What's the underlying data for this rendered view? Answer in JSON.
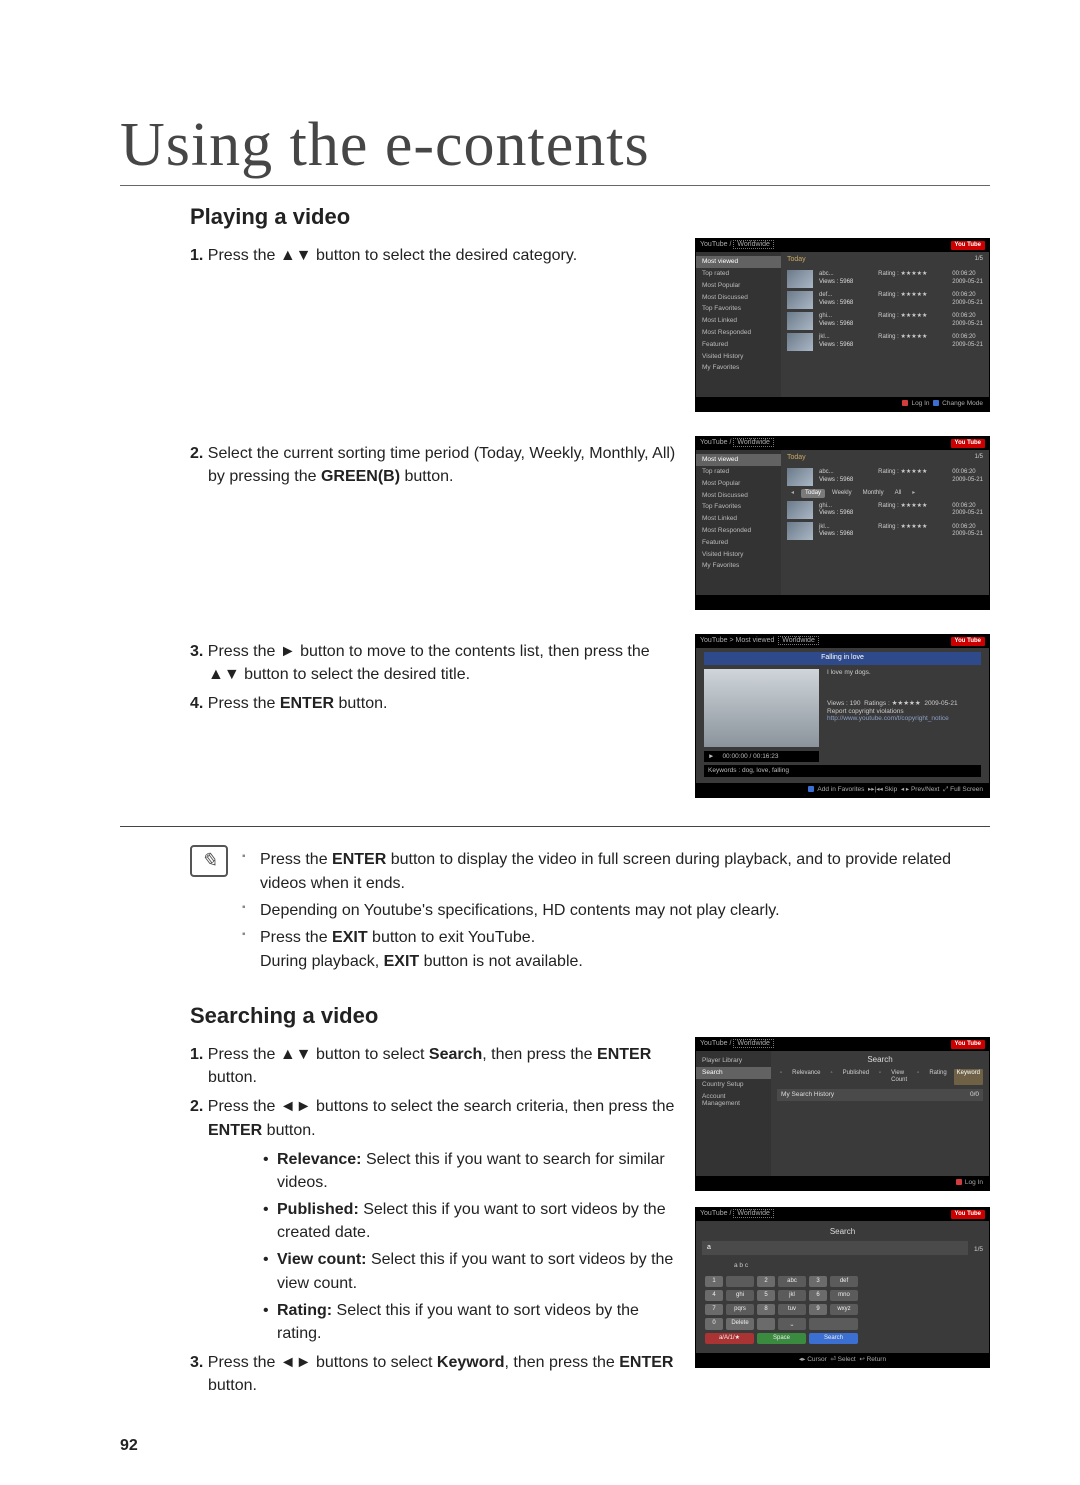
{
  "chapter_title": "Using the e-contents",
  "page_number": "92",
  "section1_title": "Playing a video",
  "section2_title": "Searching a video",
  "step1_1": "1.",
  "step1_1_text": "Press the ▲▼ button to select the desired category.",
  "step1_2a": "2.",
  "step1_2_text_a": "Select the current sorting time period (Today, Weekly, Monthly, All) by pressing the ",
  "step1_2_green": "GREEN(B)",
  "step1_2_text_b": " button.",
  "step1_3a": "3.",
  "step1_3_text": "Press the ► button to move to the contents list, then press the ▲▼ button to select the desired title.",
  "step1_4a": "4.",
  "step1_4_text_a": "Press the ",
  "step1_4_enter": "ENTER",
  "step1_4_text_b": " button.",
  "notes": {
    "n1_a": "Press the ",
    "n1_enter": "ENTER",
    "n1_b": " button to display the video in full screen during playback, and to provide related videos when it ends.",
    "n2": "Depending on Youtube's specifications, HD contents may not play clearly.",
    "n3_a": "Press the ",
    "n3_exit1": "EXIT",
    "n3_b": " button to exit YouTube.",
    "n3_c": "During playback, ",
    "n3_exit2": "EXIT",
    "n3_d": " button is not available."
  },
  "search_steps": {
    "s1_num": "1.",
    "s1_a": "Press the ▲▼ button to select ",
    "s1_search": "Search",
    "s1_b": ", then press the ",
    "s1_enter": "ENTER",
    "s1_c": " button.",
    "s2_num": "2.",
    "s2_a": "Press the ◄► buttons to select the search criteria, then press the ",
    "s2_enter": "ENTER",
    "s2_b": " button.",
    "s3_num": "3.",
    "s3_a": "Press the ◄► buttons to select ",
    "s3_kw": "Keyword",
    "s3_b": ", then press the ",
    "s3_enter": "ENTER",
    "s3_c": " button."
  },
  "search_criteria": {
    "relevance_label": "Relevance:",
    "relevance": " Select this if you want to search for similar videos.",
    "published_label": "Published:",
    "published": " Select this if you want to sort videos by the created date.",
    "viewcount_label": "View count:",
    "viewcount": " Select this if you want to sort videos by the view count.",
    "rating_label": "Rating:",
    "rating": " Select this if you want to sort videos by the rating."
  },
  "mock": {
    "breadcrumb": "YouTube / ",
    "worldwide": "Worldwide",
    "logo": "You Tube",
    "page_indicator": "1/5",
    "period": "Today",
    "side": {
      "most_viewed": "Most viewed",
      "top_rated": "Top rated",
      "most_popular": "Most Popular",
      "most_discussed": "Most Discussed",
      "top_favorites": "Top Favorites",
      "most_linked": "Most Linked",
      "most_responded": "Most Responded",
      "featured": "Featured",
      "visited_history": "Visited History",
      "my_favorites": "My Favorites"
    },
    "rows": {
      "titles": [
        "abc...",
        "def...",
        "ghi...",
        "jkl..."
      ],
      "views": "Views : 5968",
      "rating": "Rating : ★★★★★",
      "duration": "00:06:20",
      "date": "2009-05-21"
    },
    "sort": {
      "today": "Today",
      "weekly": "Weekly",
      "monthly": "Monthly",
      "all": "All"
    },
    "bottom_login": "Log In",
    "bottom_change": "Change Mode",
    "detail": {
      "breadcrumb": "YouTube > Most viewed",
      "banner": "Falling in love",
      "subtitle": "I love my dogs.",
      "meta1": "Views : 190",
      "meta2": "Ratings : ★★★★★",
      "meta3": "2009-05-21",
      "report": "Report copyright violations",
      "link": "http://www.youtube.com/t/copyright_notice",
      "playtime": "00:00:00 / 00:16:23",
      "keywords_label": "Keywords :",
      "keywords": "dog, love, falling",
      "bottom_fav": "Add in Favorites",
      "bottom_skip": "Skip",
      "bottom_prev": "Prev/Next",
      "bottom_full": "Full Screen"
    },
    "search": {
      "side_player": "Player Library",
      "side_search": "Search",
      "side_country": "Country Setup",
      "side_account": "Account Management",
      "title": "Search",
      "f_relevance": "Relevance",
      "f_published": "Published",
      "f_viewcount": "View Count",
      "f_rating": "Rating",
      "f_keyword": "Keyword",
      "hist_label": "My Search History",
      "hist_count": "0/0"
    },
    "kbd": {
      "input": "a",
      "heading": "a b c",
      "keys": [
        [
          "1",
          "",
          "2",
          "abc",
          "3",
          "def"
        ],
        [
          "4",
          "ghi",
          "5",
          "jkl",
          "6",
          "mno"
        ],
        [
          "7",
          "pqrs",
          "8",
          "tuv",
          "9",
          "wxyz"
        ],
        [
          "0",
          "Delete",
          "",
          "⎵",
          "",
          ""
        ]
      ],
      "aA": "a/A/1/★",
      "space": "Space",
      "search": "Search",
      "cursor": "Cursor",
      "select": "Select",
      "return": "Return"
    }
  }
}
